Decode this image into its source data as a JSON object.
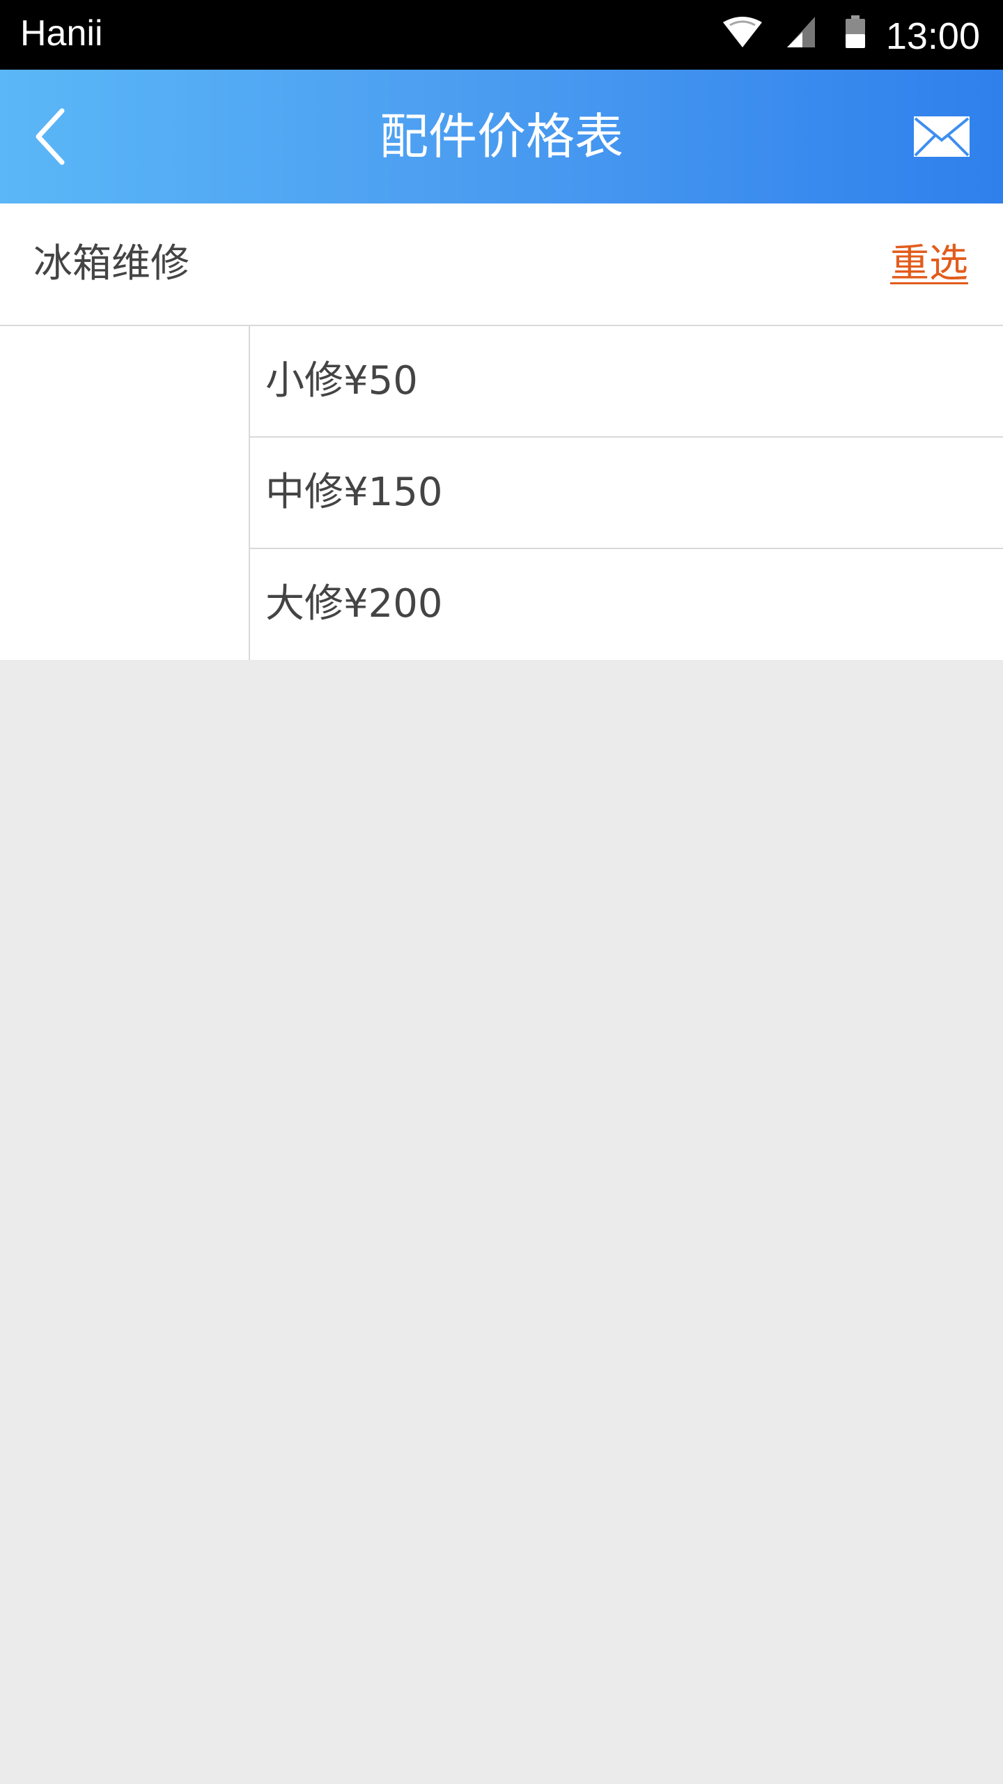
{
  "status_bar": {
    "carrier": "Hanii",
    "time": "13:00",
    "icons": [
      "wifi-icon",
      "signal-icon",
      "battery-icon"
    ]
  },
  "app_bar": {
    "title": "配件价格表",
    "back_icon": "chevron-left-icon",
    "mail_icon": "envelope-icon",
    "gradient_start": "#5bb7f7",
    "gradient_end": "#2f80ec"
  },
  "category": {
    "name": "冰箱维修",
    "reselect_label": "重选",
    "reselect_color": "#e25c1c"
  },
  "price_list": [
    {
      "label": "小修¥50"
    },
    {
      "label": "中修¥150"
    },
    {
      "label": "大修¥200"
    }
  ],
  "colors": {
    "page_background": "#ebebeb",
    "text": "#444444",
    "divider": "#d9d9d9"
  }
}
